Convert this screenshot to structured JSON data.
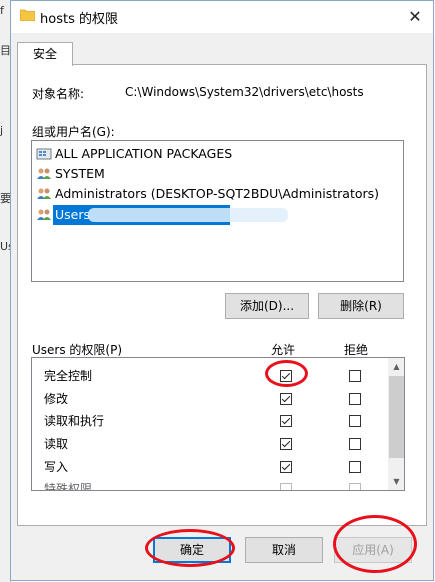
{
  "window": {
    "title": "hosts 的权限",
    "close_glyph": "✕"
  },
  "behind_window_fragments": [
    "f",
    "目",
    "j",
    "要",
    "Us"
  ],
  "tabs": [
    {
      "label": "安全"
    }
  ],
  "object": {
    "label": "对象名称:",
    "value": "C:\\Windows\\System32\\drivers\\etc\\hosts"
  },
  "groups": {
    "label": "组或用户名(G):",
    "items": [
      {
        "label": "ALL APPLICATION PACKAGES",
        "icon": "app-packages-icon",
        "selected": false
      },
      {
        "label": "SYSTEM",
        "icon": "users-group-icon",
        "selected": false
      },
      {
        "label": "Administrators (DESKTOP-SQT2BDU\\Administrators)",
        "icon": "users-group-icon",
        "selected": false
      },
      {
        "label": "Users",
        "icon": "users-group-icon",
        "selected": true
      }
    ]
  },
  "buttons": {
    "add": "添加(D)...",
    "remove": "删除(R)",
    "ok": "确定",
    "cancel": "取消",
    "apply": "应用(A)"
  },
  "permissions": {
    "label": "Users 的权限(P)",
    "allow_header": "允许",
    "deny_header": "拒绝",
    "rows": [
      {
        "name": "完全控制",
        "allow": true,
        "deny": false
      },
      {
        "name": "修改",
        "allow": true,
        "deny": false
      },
      {
        "name": "读取和执行",
        "allow": true,
        "deny": false
      },
      {
        "name": "读取",
        "allow": true,
        "deny": false
      },
      {
        "name": "写入",
        "allow": true,
        "deny": false
      },
      {
        "name": "特殊权限",
        "allow": false,
        "deny": false
      }
    ]
  },
  "colors": {
    "selection": "#0078d7",
    "annotation": "#e8101a",
    "dialog_bg": "#f0f0f0"
  }
}
